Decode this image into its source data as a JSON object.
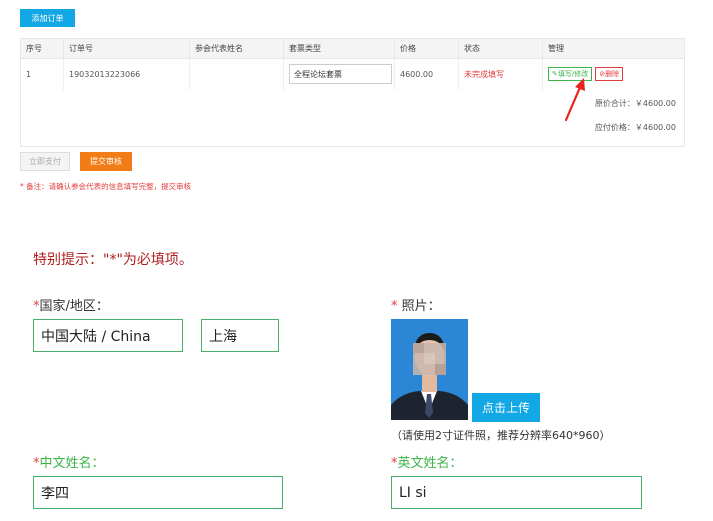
{
  "order": {
    "add_button": "添加订单",
    "columns": [
      "序号",
      "订单号",
      "参会代表姓名",
      "套票类型",
      "价格",
      "状态",
      "管理"
    ],
    "rows": [
      {
        "index": "1",
        "order_no": "19032013223066",
        "attendee_name": "",
        "ticket_type": "全程论坛套票",
        "price": "4600.00",
        "status": "未完成填写",
        "edit_label": "✎填写/修改",
        "delete_label": "⊘删除"
      }
    ],
    "original_total": "原价合计：￥4600.00",
    "payable_total": "应付价格：￥4600.00",
    "pay_button": "立即支付",
    "submit_button": "提交审核",
    "note": "* 备注：请确认参会代表的信息填写完整，提交审核"
  },
  "form": {
    "tip": "特别提示：\"*\"为必填项。",
    "country_label": "国家/地区：",
    "country_value": "中国大陆 / China",
    "city_value": "上海",
    "photo_label": "照片：",
    "upload_button": "点击上传",
    "photo_hint": "（请使用2寸证件照，推荐分辨率640*960）",
    "cn_name_label": "中文姓名：",
    "cn_name_value": "李四",
    "en_name_label": "英文姓名：",
    "en_name_value": "LI si",
    "required_mark": "*"
  },
  "colors": {
    "primary_blue": "#12a7e5",
    "orange": "#f27c16",
    "red": "#e23c3c",
    "green": "#48b06a"
  }
}
